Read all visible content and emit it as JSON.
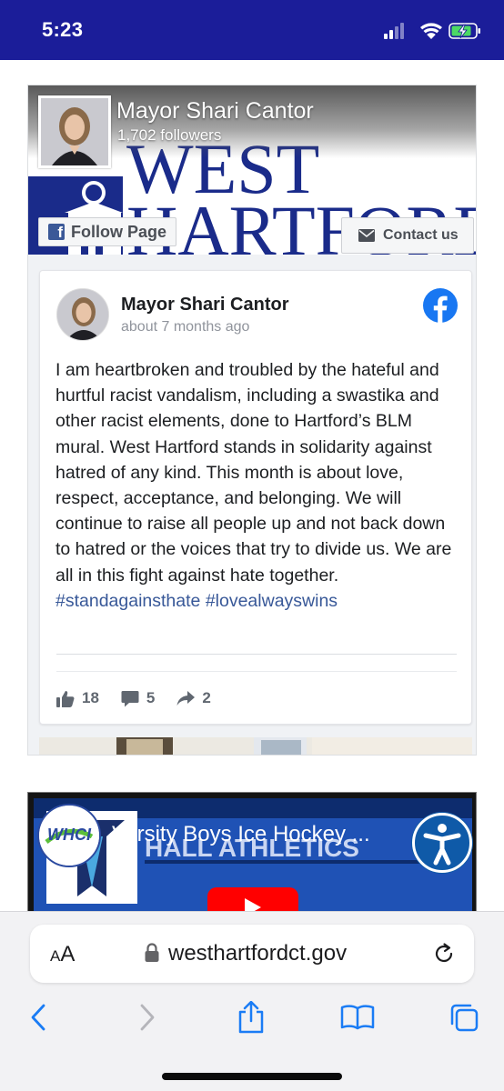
{
  "status_bar": {
    "time": "5:23"
  },
  "fb_page": {
    "name": "Mayor Shari Cantor",
    "followers": "1,702 followers",
    "cover_text_line1": "WEST",
    "cover_text_line2": "HARTFORD",
    "follow_label": "Follow Page",
    "contact_label": "Contact us"
  },
  "post": {
    "author": "Mayor Shari Cantor",
    "time": "about 7 months ago",
    "text": "I am heartbroken and troubled by the hateful and hurtful racist vandalism, including a swastika and other racist elements, done to Hartford’s BLM mural. West Hartford stands in solidarity against hatred of any kind. This month is about love, respect, acceptance, and belonging. We will continue to raise all people up and not back down to hatred or the voices that try to divide us. We are all in this fight against hate together.",
    "hashtag1": "#standagainsthate",
    "hashtag2": "#lovealwayswins",
    "likes": "18",
    "comments": "5",
    "shares": "2"
  },
  "video": {
    "title": "Varsity Boys Ice Hockey ...",
    "banner_text": "HALL ATHLETICS",
    "channel_text": "WHCI"
  },
  "browser": {
    "aa_label_small": "A",
    "aa_label_large": "A",
    "url": "westhartfordct.gov"
  },
  "colors": {
    "status_bar": "#1b1d99",
    "facebook_blue": "#1877f2",
    "hashtag": "#385898"
  }
}
